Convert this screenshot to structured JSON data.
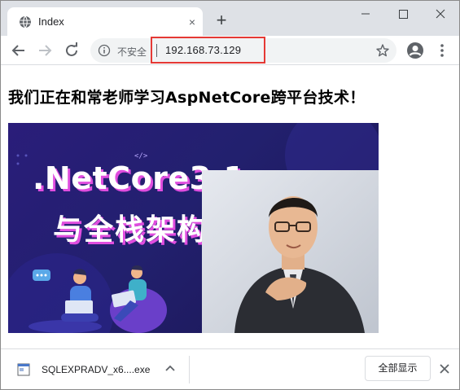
{
  "tab": {
    "title": "Index",
    "favicon": "globe-icon",
    "close": "×"
  },
  "new_tab": "+",
  "toolbar": {
    "insecure_label": "不安全",
    "url": "192.168.73.129",
    "highlight_color": "#e53935"
  },
  "page": {
    "headline": "我们正在和常老师学习AspNetCore跨平台技术！",
    "banner": {
      "code_tag": "</>",
      "title_line1": ".NetCore3.1",
      "title_line2": "与全栈架构",
      "accent_color": "#e04ddf",
      "background_color": "#22206e"
    }
  },
  "downloads": {
    "file_name": "SQLEXPRADV_x6....exe",
    "show_all_label": "全部显示"
  }
}
